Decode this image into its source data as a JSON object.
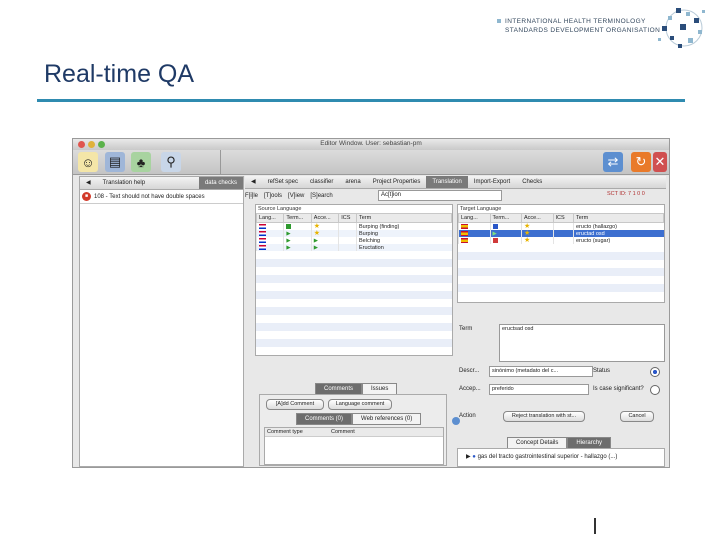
{
  "slide": {
    "title": "Real-time QA",
    "org_line1": "INTERNATIONAL HEALTH TERMINOLOGY",
    "org_line2": "STANDARDS DEVELOPMENT ORGANISATION",
    "accent_color": "#2f8bb0"
  },
  "window": {
    "title": "Editor Window. User: sebastian-pm"
  },
  "toolbar": {
    "icons": [
      "new-concept-icon",
      "edit-icon",
      "tree-icon",
      "search-icon",
      "sync-icon",
      "refresh-icon",
      "cancel-icon"
    ]
  },
  "left_panel": {
    "tabs": [
      {
        "label": "Translation help",
        "active": false
      },
      {
        "label": "data checks",
        "active": true
      }
    ],
    "message": "108 - Text should not have double spaces"
  },
  "main_tabs": [
    {
      "label": "refSet spec",
      "active": false
    },
    {
      "label": "classifier",
      "active": false
    },
    {
      "label": "arena",
      "active": false
    },
    {
      "label": "Project Properties",
      "active": false
    },
    {
      "label": "Translation",
      "active": true
    },
    {
      "label": "Import-Export",
      "active": false
    },
    {
      "label": "Checks",
      "active": false
    }
  ],
  "menu": {
    "items": [
      "F[i]le",
      "[T]ools",
      "[V]iew",
      "[S]earch",
      "Ac[t]ion"
    ],
    "sctid": "SCT ID: 7 1 0 0"
  },
  "source_language": {
    "label": "Source Language",
    "columns": [
      "Lang...",
      "Term...",
      "Acce...",
      "ICS",
      "Term"
    ],
    "rows": [
      {
        "term": "Burping (finding)"
      },
      {
        "term": "Burping"
      },
      {
        "term": "Belching"
      },
      {
        "term": "Eructation"
      }
    ]
  },
  "target_language": {
    "label": "Target Language",
    "columns": [
      "Lang...",
      "Term...",
      "Acce...",
      "ICS",
      "Term"
    ],
    "rows": [
      {
        "term": "eructo (hallazgo)",
        "selected": false
      },
      {
        "term": "eructad  osd",
        "selected": true
      },
      {
        "term": "eructo (sugar)",
        "selected": false
      }
    ]
  },
  "editor": {
    "term_label": "Term",
    "term_value": "eructsad  osd",
    "desc_label": "Descr...",
    "desc_value": "sinónimo (metadato del c...",
    "status_label": "Status",
    "accept_label": "Accep...",
    "accept_value": "preferido",
    "case_label": "Is case significant?",
    "action_label": "Action",
    "action_value": "Reject translation with st...",
    "cancel_label": "Cancel"
  },
  "comments": {
    "tabs": [
      {
        "label": "Comments",
        "active": true
      },
      {
        "label": "Issues",
        "active": false
      }
    ],
    "add_comment": "[A]dd Comment",
    "language_comment": "Language comment",
    "subtabs": [
      {
        "label": "Comments (0)",
        "active": true
      },
      {
        "label": "Web references (0)",
        "active": false
      }
    ],
    "columns": [
      "Comment type",
      "Comment"
    ]
  },
  "concept_details": {
    "tabs": [
      {
        "label": "Concept Details",
        "active": true
      },
      {
        "label": "Hierarchy",
        "active": false
      }
    ],
    "row": "gas del tracto gastrointestinal superior - hallazgo (...)"
  }
}
